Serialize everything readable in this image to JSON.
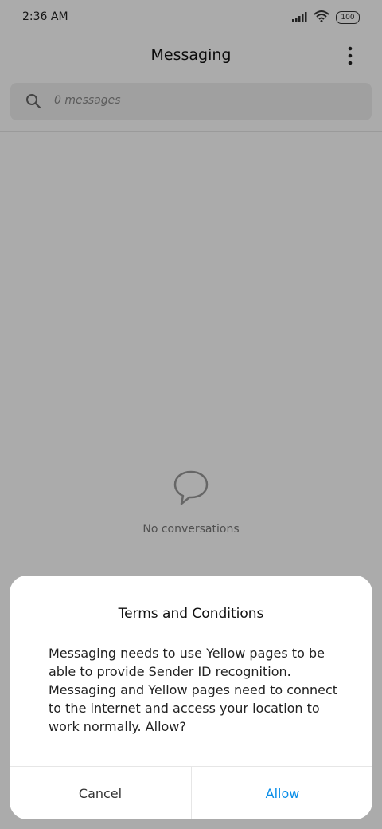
{
  "status_bar": {
    "time": "2:36 AM",
    "battery": "100",
    "icons": [
      "signal-icon",
      "wifi-icon",
      "battery-icon"
    ]
  },
  "header": {
    "title": "Messaging",
    "menu_icon": "more-vertical-icon"
  },
  "search": {
    "placeholder": "0 messages",
    "icon": "search-icon"
  },
  "empty_state": {
    "icon": "chat-bubble-icon",
    "text": "No conversations"
  },
  "dialog": {
    "title": "Terms and Conditions",
    "body": "Messaging needs to use Yellow pages to be able to provide Sender ID recognition. Messaging and Yellow pages need to connect to the internet and access your location to work normally. Allow?",
    "cancel_label": "Cancel",
    "allow_label": "Allow"
  },
  "colors": {
    "accent": "#0a8ee8",
    "overlay": "#b2b2b2"
  }
}
